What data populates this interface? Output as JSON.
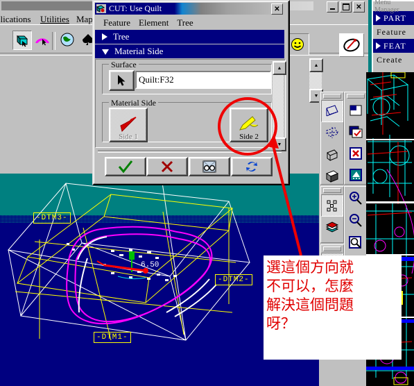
{
  "main_window": {
    "menus": [
      "plications",
      "Utilities",
      "Mapk"
    ],
    "window_buttons": {
      "minimize": "_",
      "maximize": "□",
      "close": "✕"
    },
    "toolbar_icons": [
      "quilt-surface-icon",
      "curve-icon",
      "globe-icon",
      "spade-icon",
      "smiley-icon",
      "pen-annotate-icon"
    ]
  },
  "dialog": {
    "title": "CUT: Use Quilt",
    "close_label": "✕",
    "menus": [
      "Feature",
      "Element",
      "Tree"
    ],
    "nav_tree_label": "Tree",
    "nav_material_side_label": "Material Side",
    "surface_group_label": "Surface",
    "surface_value": "Quilt:F32",
    "surface_picker_icon": "select-arrow-icon",
    "material_side_group_label": "Material Side",
    "side1_label": "Side 1",
    "side1_icon": "red-arrow-icon",
    "side2_label": "Side 2",
    "side2_icon": "yellow-arrow-icon",
    "buttons": [
      {
        "name": "ok",
        "icon": "green-check-icon"
      },
      {
        "name": "cancel",
        "icon": "red-x-icon"
      },
      {
        "name": "preview",
        "icon": "glasses-preview-icon"
      },
      {
        "name": "refresh",
        "icon": "blue-refresh-icon"
      }
    ],
    "scroll_up": "▲",
    "scroll_down": "▼"
  },
  "menu_manager": {
    "title": "Menu Manager",
    "items": [
      {
        "label": "PART",
        "selected": true
      },
      {
        "label": "Feature",
        "selected": false
      },
      {
        "label": "FEAT",
        "selected": true
      },
      {
        "label": "Create",
        "selected": false
      }
    ]
  },
  "right_toolbar": {
    "groups": [
      {
        "icons": [
          "datum-plane-icon",
          "datum-axis-icon",
          "datum-point-icon",
          "datum-surface-icon"
        ]
      },
      {
        "icons": [
          "datum-points-pattern-icon",
          "layers-icon"
        ]
      },
      {
        "icons": [
          "sketch-plane-icon"
        ]
      }
    ],
    "groups_right": [
      {
        "icons": [
          "window-new-icon",
          "window-check-icon",
          "window-delete-icon",
          "window-shade-icon"
        ]
      },
      {
        "icons": [
          "zoom-in-icon",
          "zoom-out-icon",
          "zoom-area-icon",
          "refit-icon"
        ]
      }
    ]
  },
  "viewport": {
    "background_top": "#008080",
    "background_bottom": "#000080",
    "datum_labels": [
      "-DTM3-",
      "-DTM2-",
      "-DTM1-"
    ],
    "dimension_label": "6.50"
  },
  "annotation": {
    "lines": [
      "選這個方向就",
      "不可以，怎麼",
      "解決這個問題",
      "呀？"
    ],
    "color": "#e00000",
    "circle_target": "side2-button"
  },
  "colors": {
    "teal": "#008080",
    "navy": "#000080",
    "face": "#c0c0c0",
    "yellow": "#ffff00",
    "magenta": "#ff00ff",
    "annotation_red": "#e00000"
  }
}
